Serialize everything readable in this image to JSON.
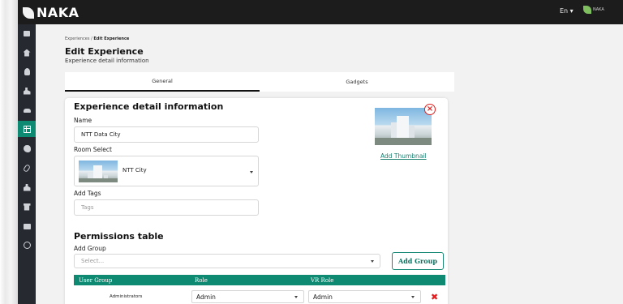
{
  "app": {
    "logo": "NAKA",
    "lang": "En ▾",
    "brand_mini": "NAKA"
  },
  "breadcrumb": {
    "parent": "Experiences",
    "sep": " / ",
    "current": "Edit Experience"
  },
  "page": {
    "title": "Edit Experience",
    "subtitle": "Experience detail information"
  },
  "tabs": [
    {
      "label": "General",
      "active": true
    },
    {
      "label": "Gadgets",
      "active": false
    }
  ],
  "details": {
    "title": "Experience detail information",
    "name_label": "Name",
    "name_value": "NTT Data City",
    "room_label": "Room Select",
    "room_value": "NTT City",
    "tags_label": "Add Tags",
    "tags_placeholder": "Tags",
    "thumbnail_close": "×",
    "add_thumbnail": "Add Thumbnail"
  },
  "permissions": {
    "title": "Permissions table",
    "add_group_label": "Add Group",
    "select_placeholder": "Select...",
    "add_group_button": "Add Group",
    "headers": [
      "User Group",
      "Role",
      "VR Role"
    ],
    "rows": [
      {
        "group": "Administrators",
        "role": "Admin",
        "vr_role": "Admin",
        "delete": "✖"
      }
    ]
  },
  "sidebar": {
    "items": [
      {
        "icon": "square-icon"
      },
      {
        "icon": "home-icon"
      },
      {
        "icon": "user-icon"
      },
      {
        "icon": "users-icon"
      },
      {
        "icon": "car-icon"
      },
      {
        "icon": "grid-icon",
        "active": true
      },
      {
        "icon": "palette-icon"
      },
      {
        "icon": "paperclip-icon"
      },
      {
        "icon": "person-icon"
      },
      {
        "icon": "store-icon"
      },
      {
        "icon": "briefcase-icon"
      },
      {
        "icon": "coin-icon"
      }
    ]
  },
  "colors": {
    "accent": "#0e8a73",
    "topbar": "#1c1c1c",
    "sidebar": "#262a30",
    "danger": "#e02020"
  }
}
